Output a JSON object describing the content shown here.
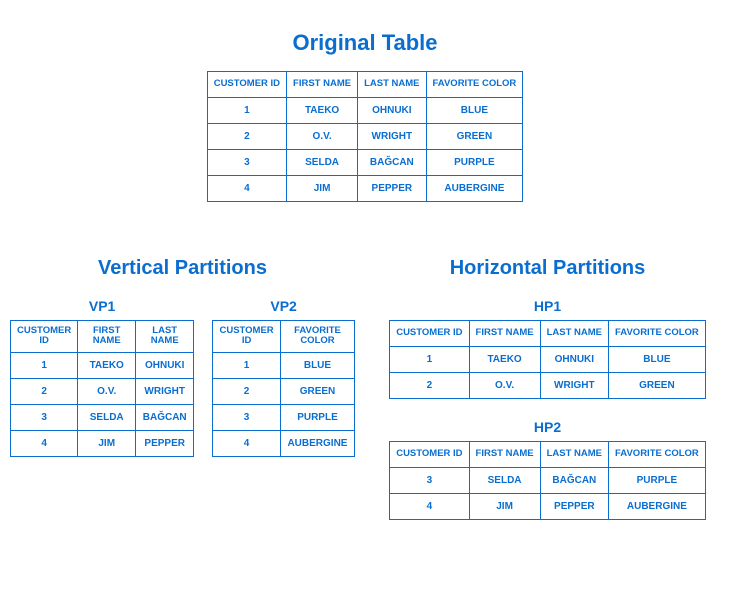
{
  "titles": {
    "original": "Original Table",
    "vertical": "Vertical Partitions",
    "horizontal": "Horizontal Partitions",
    "vp1": "VP1",
    "vp2": "VP2",
    "hp1": "HP1",
    "hp2": "HP2"
  },
  "headers": {
    "customer_id": "CUSTOMER ID",
    "first_name": "FIRST NAME",
    "last_name": "LAST NAME",
    "favorite_color": "FAVORITE COLOR"
  },
  "rows": [
    {
      "id": "1",
      "first": "TAEKO",
      "last": "OHNUKI",
      "color": "BLUE"
    },
    {
      "id": "2",
      "first": "O.V.",
      "last": "WRIGHT",
      "color": "GREEN"
    },
    {
      "id": "3",
      "first": "SELDA",
      "last": "BAĞCAN",
      "color": "PURPLE"
    },
    {
      "id": "4",
      "first": "JIM",
      "last": "PEPPER",
      "color": "AUBERGINE"
    }
  ]
}
